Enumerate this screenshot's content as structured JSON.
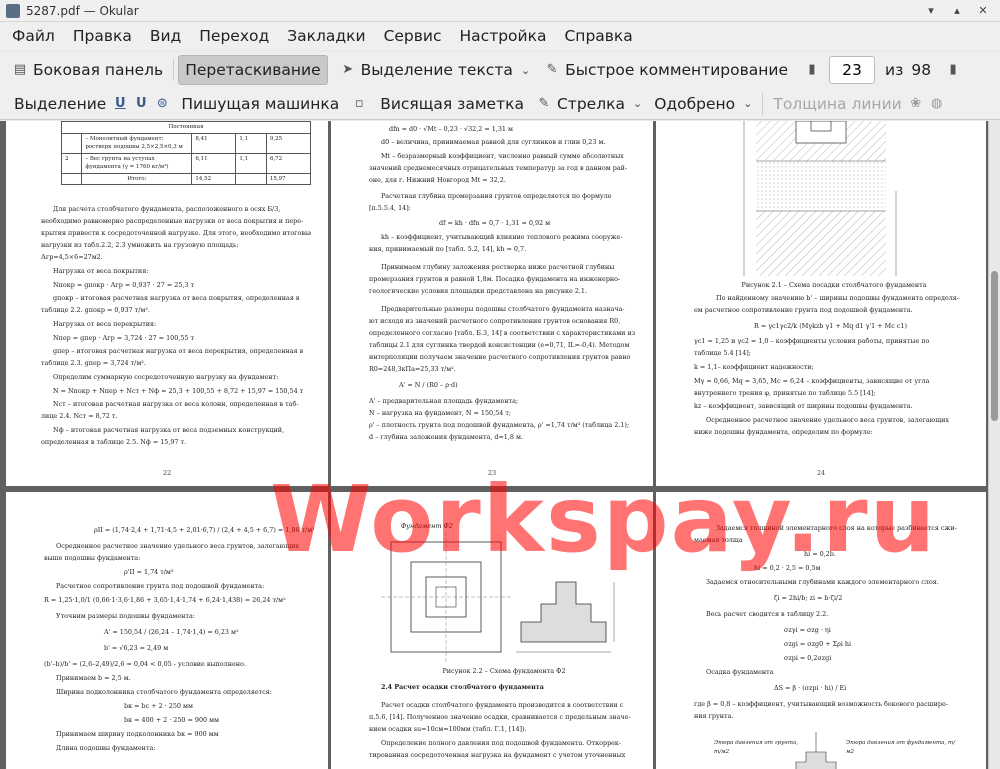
{
  "window": {
    "title": "5287.pdf — Okular"
  },
  "menu": [
    "Файл",
    "Правка",
    "Вид",
    "Переход",
    "Закладки",
    "Сервис",
    "Настройка",
    "Справка"
  ],
  "toolbar1": {
    "sidebar": "Боковая панель",
    "drag": "Перетаскивание",
    "text_select": "Выделение текста",
    "quick_comment": "Быстрое комментирование",
    "page_current": "23",
    "page_of": "из",
    "page_total": "98"
  },
  "toolbar2": {
    "highlight": "Выделение",
    "typewriter": "Пишущая машинка",
    "sticky": "Висящая заметка",
    "arrow": "Стрелка",
    "stamp": "Одобрено",
    "line_width": "Толщина линии"
  },
  "watermark": "Workspay.ru",
  "pages": {
    "p22": {
      "table": {
        "header": "Постоянная",
        "rows": [
          [
            "",
            "– Монолитный фундамент: ростверк подошвы 2,5×2,5×0,3 м",
            "8,41",
            "1,1",
            "9,25"
          ],
          [
            "2",
            "– Вес грунта на уступах фундамента (γ = 1760 кг/м³)",
            "6,11",
            "1,1",
            "6,72"
          ],
          [
            "",
            "Итого:",
            "14,52",
            "",
            "15,97"
          ]
        ]
      },
      "lines": [
        "Для расчета столбчатого фундамента, расположенного в осях Б/3,",
        "необходимо равномерно распределенные нагрузки от веса покрытия и пере-",
        "крытия привести к сосредоточенной нагрузке. Для этого, необходимо итоговые",
        "нагрузки из табл.2.2, 2.3 умножить на грузовую площадь:",
        "Агр=4,5×6=27м2.",
        "Нагрузка от веса покрытия:",
        "Nпокр = gпокр · Агр = 0,937 · 27 = 25,3 т",
        "gпокр – итоговая расчетная нагрузка от веса покрытия, определенная в",
        "таблице 2.2. gпокр = 0,937 т/м².",
        "Нагрузка от веса перекрытия:",
        "Nпер = gпер · Агр = 3,724 · 27 = 100,55 т",
        "gпер – итоговая расчетная нагрузка от веса перекрытия, определенная в",
        "таблице 2.3. gпер = 3,724 т/м².",
        "Определим суммарную сосредоточенную нагрузку на фундамент:",
        "N = Nпокр + Nпер + Nст + Nф = 25,3 + 100,55 + 8,72 + 15,97 = 150,54 т",
        "Nст – итоговая расчетная нагрузка от веса колонн, определенная в таб-",
        "лице 2.4. Nст = 8,72 т.",
        "Nф – итоговая расчетная нагрузка от веса подземных конструкций,",
        "определенная в таблице 2.5. Nф = 15,97 т."
      ],
      "num": "22"
    },
    "p23": {
      "lines": [
        "dfn = d0 · √Mt – 0,23 · √32,2 = 1,31 м",
        "d0 – величина, принимаемая равной для суглинков и глин 0,23 м.",
        "Mt – безразмерный коэффициент, численно равный сумме абсолютных",
        "значений среднемесячных отрицательных температур за год в данном рай-",
        "оне, для г. Нижний Новгород Mt = 32,2.",
        "Расчетная глубина промерзания грунтов определяется по формуле",
        "[п.5.5.4, 14]:",
        "df = kh · dfn = 0,7 · 1,31 = 0,92 м",
        "kh – коэффициент, учитывающий влияние теплового режима сооруже-",
        "ния, принимаемый по [табл. 5.2, 14], kh = 0,7.",
        "Принимаем глубину заложения ростверка ниже расчетной глубины",
        "промерзания грунтов и равной 1,8м. Посадка фундамента на инженерно-",
        "геологические условия площадки представлена на рисунке 2.1.",
        "Предварительные размеры подошвы столбчатого фундамента назнача-",
        "ют исходя из значений расчетного сопротивления грунтов основания R0,",
        "определенного согласно [табл. Б.3, 14] в соответствии с характеристиками из",
        "таблицы 2.1 для суглинка твердой консистенции (e=0,71, IL=-0,4). Методом",
        "интерполяции получаем значение расчетного сопротивления грунтов равно",
        "R0=248,3кПа=25,33 т/м².",
        "A' = N / (R0 – ρ·d)",
        "A' – предварительная площадь фундамента;",
        "N – нагрузка на фундамент, N = 150,54 т;",
        "ρ' – плотность грунта под подошвой фундамента, ρ' =1,74 т/м³ (таблица 2.1);",
        "d – глубина заложения фундамента, d=1,8 м."
      ],
      "num": "23"
    },
    "p24": {
      "caption": "Рисунок 2.1 – Схема посадки столбчатого фундамента",
      "lines": [
        "По найденному значению b' – ширины подошвы фундамента определя-",
        "ем расчетное сопротивление грунта под подошвой фундамента.",
        "R = γc1γc2/k (Mγkzb γ1 + Mq d1 γ'1 + Mc c1)",
        "γc1 = 1,25 и γc2 = 1,0 – коэффициенты условия работы, принятые по",
        "таблице 5.4 [14];",
        "k = 1,1– коэффициент надежности;",
        "Mγ = 0,66, Mq = 3,65, Mc = 6,24 – коэффициенты, зависящие от угла",
        "внутреннего трения φ, принятые по таблице 5.5 [14];",
        "kz – коэффициент, зависящий от ширины подошвы фундамента.",
        "Осредненное расчетное значение удельного веса грунтов, залегающих",
        "ниже подошвы фундамента, определим по формуле:"
      ],
      "num": "24"
    },
    "p25": {
      "lines": [
        "ρII = (1,74·2,4 + 1,71·4,5 + 2,01·6,7) / (2,4 + 4,5 + 6,7) = 1,86 т/м³",
        "Осредненное расчетное значение удельного веса грунтов, залегающих",
        "выше подошвы фундамента:",
        "ρ'II = 1,74 т/м³",
        "Расчетное сопротивление грунта под подошвой фундамента:",
        "R = 1,25·1,0/1 (0,66·1·3,6·1,86 + 3,65·1,4·1,74 + 6,24·1,438) = 26,24 т/м²",
        "Уточним размеры подошвы фундамента:",
        "A' = 150,54 / (26,24 – 1,74·1,4) = 6,23 м²",
        "b' = √6,23 = 2,49 м",
        "(b'–b)/b' = (2,6–2,49)/2,6 = 0,04 < 0,05 - условие выполнено.",
        "Принимаем b = 2,5 м.",
        "Ширина подколонника столбчатого фундамента определяется:",
        "bк = bс + 2 · 250 мм",
        "bк = 400 + 2 · 250 = 900 мм",
        "Принимаем ширину подколонника bк = 900 мм",
        "Длина подошвы фундамента:"
      ]
    },
    "p26": {
      "label": "Фундамент Ф2",
      "caption": "Рисунок 2.2 – Схема фундамента Ф2",
      "heading": "2.4 Расчет осадки столбчатого фундамента",
      "lines": [
        "Расчет осадки столбчатого фундамента производится в соответствии с",
        "п.5.6, [14]. Полученное значение осадки, сравнивается с предельным значе-",
        "нием осадки su=10см=100мм (табл. Г.1, [14]).",
        "Определение полного давления под подошвой фундамента. Откоррек-",
        "тированная сосредоточенная нагрузка на фундамент с учетом уточненных"
      ]
    },
    "p27": {
      "lines": [
        "Задаемся толщиной элементарного слоя на которые разбивается сжи-",
        "маемая толща",
        "hi = 0,2b.",
        "hi = 0,2 · 2,5 = 0,5м",
        "Задаемся относительными глубинами каждого элементарного слоя.",
        "ζi = 2hi/b; zi = b·ζi/2",
        "Весь расчет сводится в таблицу 2.2.",
        "σzγi = σzg · ηi",
        "σzgi = σzg0 + Σρi hi",
        "σzpi = 0,2σzgi",
        "Осадка фундамента",
        "ΔS = β · (σzpi · hi) / Ei",
        "где β = 0,8 – коэффициент, учитывающий возможность бокового расшире-",
        "ния грунта."
      ],
      "legend1": "Эпюра давления от грунта, т/м2",
      "legend2": "Эпюра давления от фундамента, т/м2"
    }
  }
}
